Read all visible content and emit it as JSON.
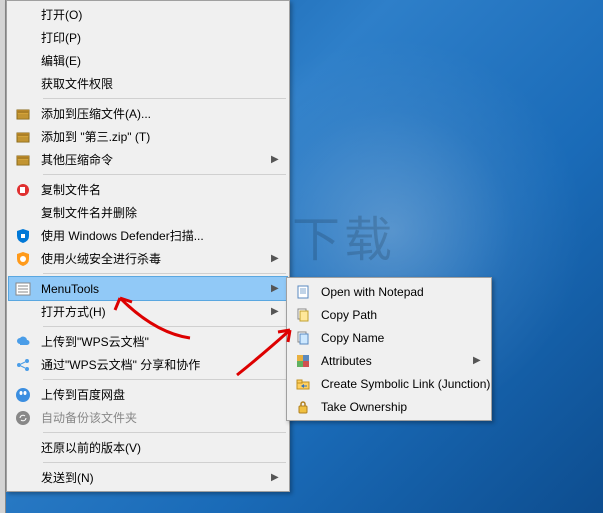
{
  "watermark_text": "安下载",
  "main_menu": {
    "items": [
      {
        "label": "打开(O)",
        "icon": null
      },
      {
        "label": "打印(P)",
        "icon": null
      },
      {
        "label": "编辑(E)",
        "icon": null
      },
      {
        "label": "获取文件权限",
        "icon": null
      },
      "sep",
      {
        "label": "添加到压缩文件(A)...",
        "icon": "archive"
      },
      {
        "label": "添加到 \"第三.zip\" (T)",
        "icon": "archive"
      },
      {
        "label": "其他压缩命令",
        "icon": "archive",
        "submenu": true
      },
      "sep",
      {
        "label": "复制文件名",
        "icon": "copy-red"
      },
      {
        "label": "复制文件名并删除",
        "icon": null
      },
      {
        "label": "使用 Windows Defender扫描...",
        "icon": "defender"
      },
      {
        "label": "使用火绒安全进行杀毒",
        "icon": "huorong",
        "submenu": true
      },
      "sep",
      {
        "label": "MenuTools",
        "icon": "menutools",
        "submenu": true,
        "highlight": true
      },
      {
        "label": "打开方式(H)",
        "icon": null,
        "submenu": true
      },
      "sep",
      {
        "label": "上传到\"WPS云文档\"",
        "icon": "wps-cloud"
      },
      {
        "label": "通过\"WPS云文档\" 分享和协作",
        "icon": "wps-share"
      },
      "sep",
      {
        "label": "上传到百度网盘",
        "icon": "baidu"
      },
      {
        "label": "自动备份该文件夹",
        "icon": "baidu-sync",
        "disabled": true
      },
      "sep",
      {
        "label": "还原以前的版本(V)",
        "icon": null
      },
      "sep",
      {
        "label": "发送到(N)",
        "icon": null,
        "submenu": true
      }
    ]
  },
  "sub_menu": {
    "items": [
      {
        "label": "Open with Notepad",
        "icon": "notepad"
      },
      {
        "label": "Copy Path",
        "icon": "copypath"
      },
      {
        "label": "Copy Name",
        "icon": "copyname"
      },
      {
        "label": "Attributes",
        "icon": "attributes",
        "submenu": true
      },
      {
        "label": "Create Symbolic Link (Junction)",
        "icon": "symlink"
      },
      {
        "label": "Take Ownership",
        "icon": "ownership"
      }
    ]
  }
}
